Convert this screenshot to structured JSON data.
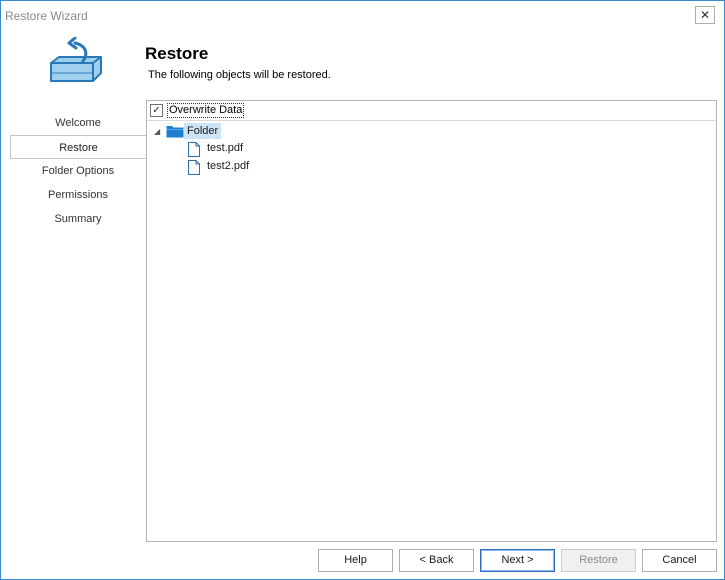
{
  "window": {
    "title": "Restore Wizard",
    "close_glyph": "✕"
  },
  "header": {
    "title": "Restore",
    "subtitle": "The following objects will be restored."
  },
  "nav": {
    "items": [
      {
        "label": "Welcome"
      },
      {
        "label": "Restore"
      },
      {
        "label": "Folder Options"
      },
      {
        "label": "Permissions"
      },
      {
        "label": "Summary"
      }
    ],
    "active_index": 1
  },
  "panel": {
    "overwrite": {
      "label": "Overwrite Data",
      "checked": true,
      "check_glyph": "✓"
    },
    "tree": {
      "expander_glyph": "◢",
      "folder": {
        "label": "Folder",
        "icon": "folder-icon"
      },
      "files": [
        {
          "label": "test.pdf",
          "icon": "file-icon"
        },
        {
          "label": "test2.pdf",
          "icon": "file-icon"
        }
      ]
    }
  },
  "buttons": {
    "help": "Help",
    "back": "< Back",
    "next": "Next >",
    "restore": "Restore",
    "cancel": "Cancel"
  },
  "colors": {
    "accent": "#3a8ad0",
    "selection": "#cce4f7",
    "folder": "#1e7fd0"
  }
}
